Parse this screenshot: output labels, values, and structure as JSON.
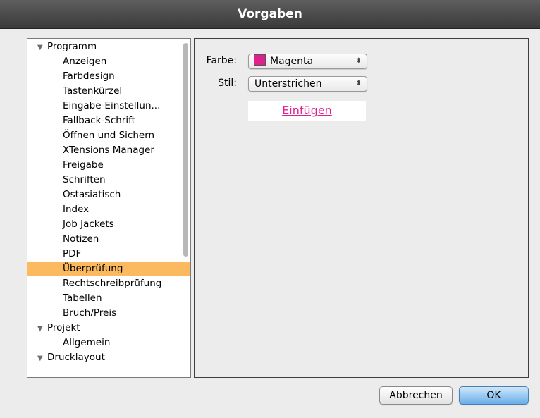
{
  "window": {
    "title": "Vorgaben"
  },
  "sidebar": {
    "items": [
      {
        "label": "Programm",
        "level": 0,
        "expanded": true
      },
      {
        "label": "Anzeigen",
        "level": 1
      },
      {
        "label": "Farbdesign",
        "level": 1
      },
      {
        "label": "Tastenkürzel",
        "level": 1
      },
      {
        "label": "Eingabe-Einstellun...",
        "level": 1
      },
      {
        "label": "Fallback-Schrift",
        "level": 1
      },
      {
        "label": "Öffnen und Sichern",
        "level": 1
      },
      {
        "label": "XTensions Manager",
        "level": 1
      },
      {
        "label": "Freigabe",
        "level": 1
      },
      {
        "label": "Schriften",
        "level": 1
      },
      {
        "label": "Ostasiatisch",
        "level": 1
      },
      {
        "label": "Index",
        "level": 1
      },
      {
        "label": "Job Jackets",
        "level": 1
      },
      {
        "label": "Notizen",
        "level": 1
      },
      {
        "label": "PDF",
        "level": 1
      },
      {
        "label": "Überprüfung",
        "level": 1,
        "selected": true
      },
      {
        "label": "Rechtschreibprüfung",
        "level": 1
      },
      {
        "label": "Tabellen",
        "level": 1
      },
      {
        "label": "Bruch/Preis",
        "level": 1
      },
      {
        "label": "Projekt",
        "level": 0,
        "expanded": true
      },
      {
        "label": "Allgemein",
        "level": 1
      },
      {
        "label": "Drucklayout",
        "level": 0,
        "expanded": true
      }
    ],
    "disclosure_icon": "disclosure-triangle-down-icon",
    "selection_color": "#fbb960"
  },
  "panel": {
    "color_label": "Farbe:",
    "color_value": "Magenta",
    "color_swatch": "#e0208e",
    "style_label": "Stil:",
    "style_value": "Unterstrichen",
    "popup_arrows_icon": "updown-arrows-icon",
    "preview_text": "Einfügen",
    "preview_color": "#e0208e"
  },
  "buttons": {
    "cancel_label": "Abbrechen",
    "ok_label": "OK"
  }
}
